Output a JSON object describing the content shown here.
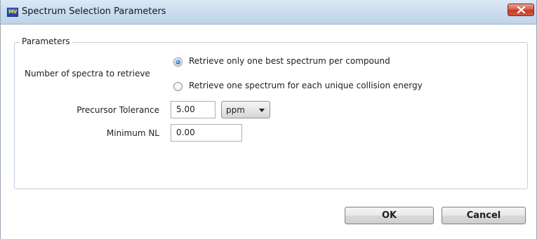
{
  "window": {
    "title": "Spectrum Selection Parameters",
    "app_icon_text": "MV"
  },
  "parameters": {
    "group_label": "Parameters",
    "spectra_label": "Number of spectra to retrieve",
    "radio_options": [
      {
        "label": "Retrieve only one best spectrum per compound",
        "selected": true
      },
      {
        "label": "Retrieve one spectrum for each unique collision energy",
        "selected": false
      }
    ],
    "precursor_tolerance": {
      "label": "Precursor Tolerance",
      "value": "5.00",
      "unit": "ppm"
    },
    "minimum_nl": {
      "label": "Minimum NL",
      "value": "0.00"
    }
  },
  "buttons": {
    "ok": "OK",
    "cancel": "Cancel"
  },
  "colors": {
    "titlebar": "#cbdcee",
    "close_button": "#c23a23",
    "radio_selected": "#2f6db3"
  }
}
